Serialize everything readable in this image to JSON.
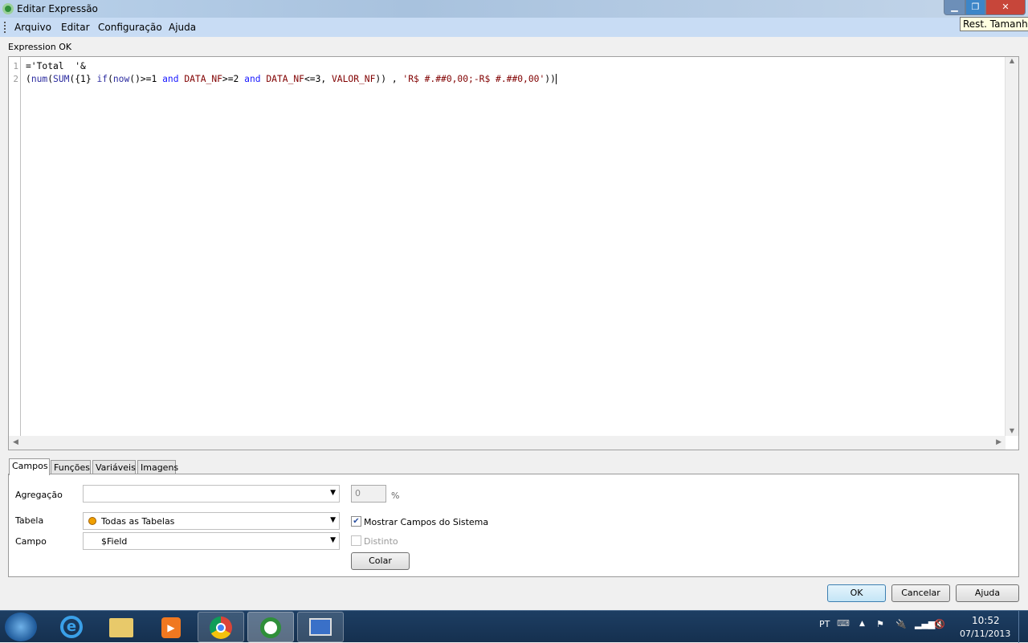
{
  "window": {
    "title": "Editar Expressão",
    "tooltip": "Rest. Tamanho",
    "minimize_icon": "minimize-icon",
    "restore_icon": "restore-icon",
    "close_icon": "close-icon"
  },
  "menu": [
    "Arquivo",
    "Editar",
    "Configuração",
    "Ajuda"
  ],
  "status": "Expression OK",
  "editor": {
    "line_numbers": [
      "1",
      "2"
    ],
    "line1": "='Total  '&",
    "line2_parts": [
      "(",
      "num",
      "(",
      "SUM",
      "({1} ",
      "if",
      "(",
      "now",
      "()>=1 ",
      "and",
      " ",
      "DATA_NF",
      ">=2 ",
      "and",
      " ",
      "DATA_NF",
      "<=3, ",
      "VALOR_NF",
      "))",
      " , ",
      "'R$ #.##0,00;-R$ #.##0,00'",
      "))"
    ]
  },
  "tabs": [
    "Campos",
    "Funções",
    "Variáveis",
    "Imagens"
  ],
  "active_tab": "Campos",
  "fields": {
    "agregacao_label": "Agregação",
    "agregacao_value": "",
    "percent_value": "0",
    "percent_sign": "%",
    "tabela_label": "Tabela",
    "tabela_value": "Todas as Tabelas",
    "campo_label": "Campo",
    "campo_value": "$Field",
    "mostrar_label": "Mostrar Campos do Sistema",
    "mostrar_checked": true,
    "distinto_label": "Distinto",
    "distinto_checked": false,
    "colar": "Colar"
  },
  "buttons": {
    "ok": "OK",
    "cancel": "Cancelar",
    "help": "Ajuda"
  },
  "taskbar": {
    "lang": "PT",
    "time": "10:52",
    "date": "07/11/2013"
  },
  "colors": {
    "function": "#2c2ca0",
    "keyword": "#1a1aff",
    "field": "#800000",
    "accent": "#3399ff"
  }
}
